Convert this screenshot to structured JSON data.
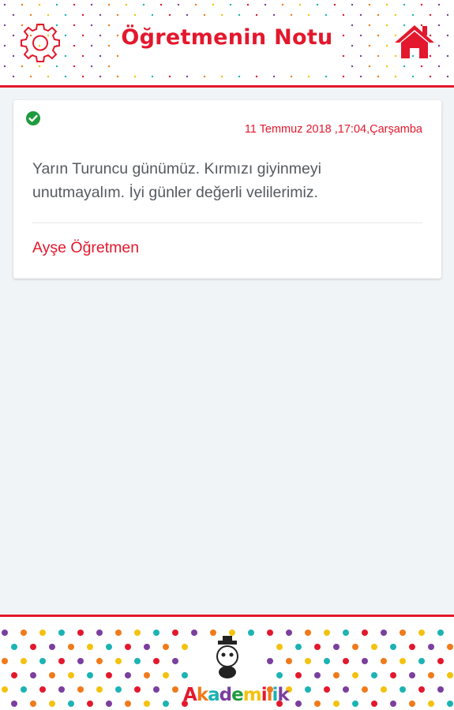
{
  "header": {
    "title": "Öğretmenin Notu",
    "settings_icon": "gear-icon",
    "home_icon": "home-icon"
  },
  "note": {
    "status_icon": "check-circle-icon",
    "date": "11 Temmuz 2018 ,17:04,Çarşamba",
    "message": "Yarın Turuncu günümüz. Kırmızı giyinmeyi unutmayalım. İyi günler değerli velilerimiz.",
    "author": "Ayşe Öğretmen"
  },
  "footer": {
    "logo_text": "Akademilik"
  },
  "colors": {
    "accent": "#e3182d",
    "background": "#f1f4f7",
    "check": "#1e9b3e",
    "dot_palette": [
      "#e3182d",
      "#f4c20d",
      "#7b3f9e",
      "#1bb3b3",
      "#f07a1a"
    ]
  }
}
